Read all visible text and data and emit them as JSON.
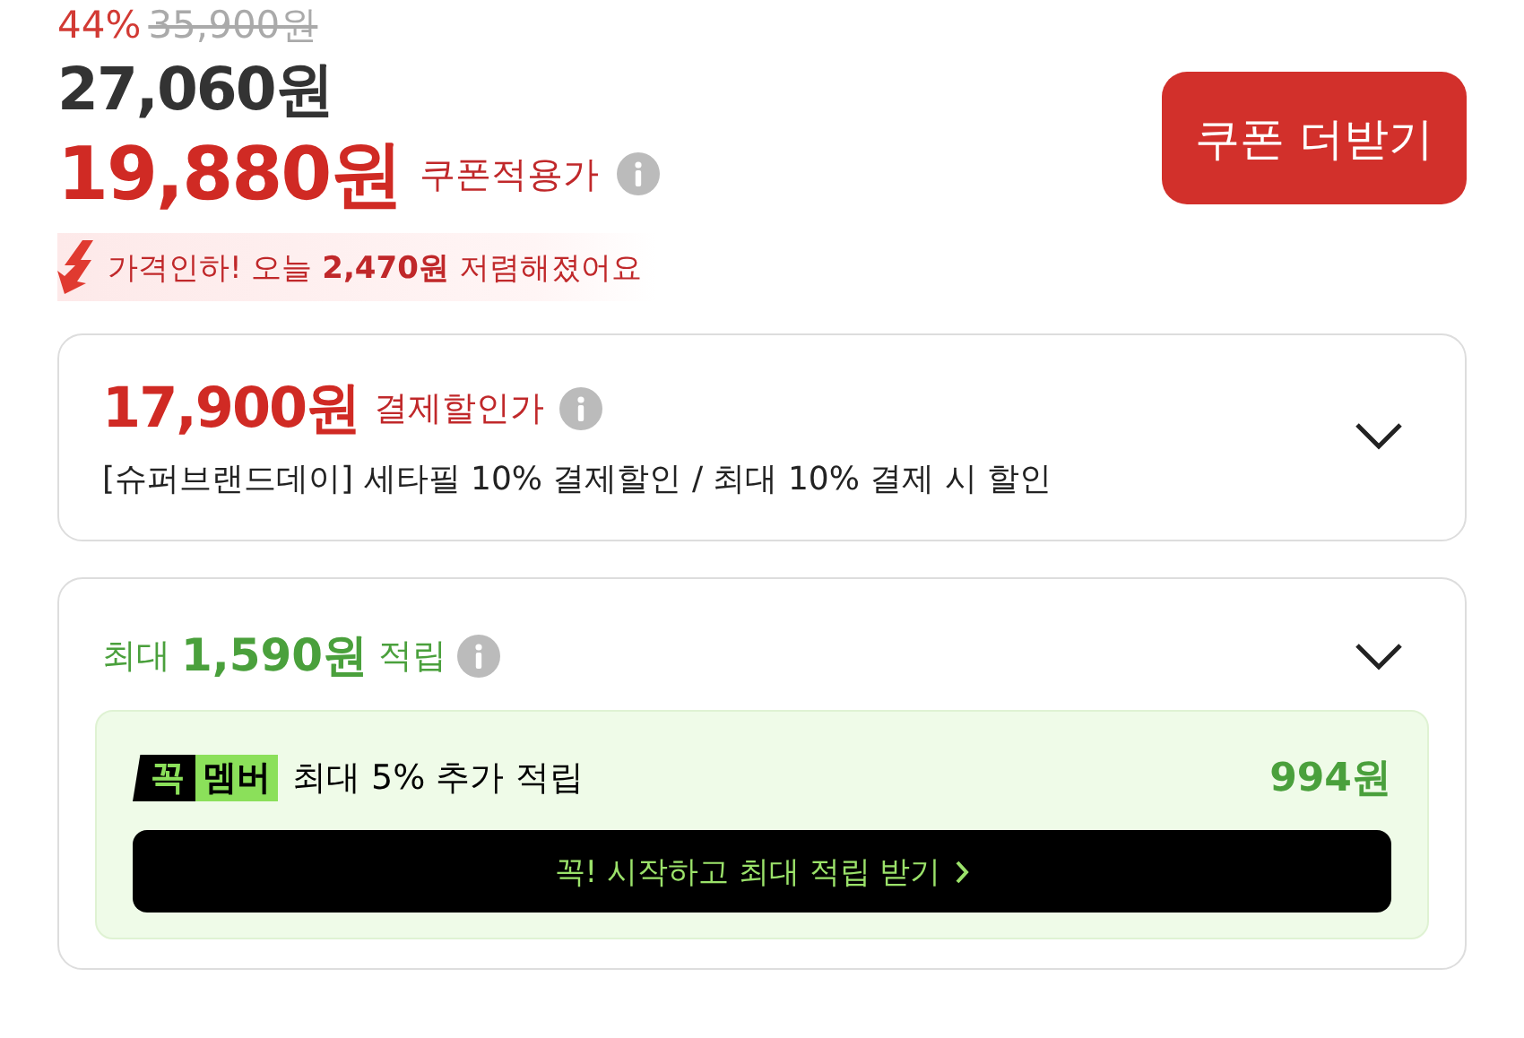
{
  "price": {
    "discount_rate": "44%",
    "original_price": "35,900원",
    "sale_price": "27,060원",
    "coupon_price": "19,880원",
    "coupon_label": "쿠폰적용가"
  },
  "coupon_button": "쿠폰 더받기",
  "price_drop": "가격인하! 오늘 **2,470원** 저렴해졌어요",
  "payment_discount": {
    "price": "17,900원",
    "label": "결제할인가",
    "description": "[슈퍼브랜드데이] 세타필 10% 결제할인 / 최대 10% 결제 시 할인"
  },
  "reward": {
    "prefix": "최대",
    "amount": "1,590원",
    "suffix": "적립",
    "membership": {
      "badge_left": "꼭",
      "badge_right": "멤버",
      "text": "최대 5% 추가 적립",
      "amount": "994원",
      "cta": "꼭! 시작하고 최대 적립 받기"
    }
  }
}
